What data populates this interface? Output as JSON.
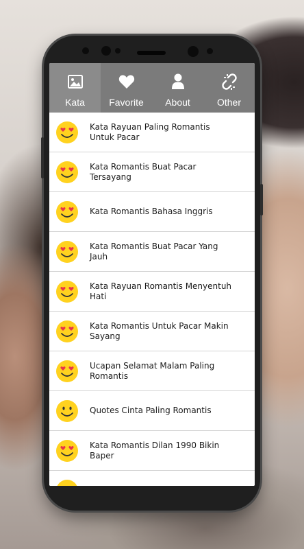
{
  "tabs": [
    {
      "label": "Kata",
      "icon": "image-icon",
      "active": true
    },
    {
      "label": "Favorite",
      "icon": "heart-icon",
      "active": false
    },
    {
      "label": "About",
      "icon": "person-icon",
      "active": false
    },
    {
      "label": "Other",
      "icon": "broken-link-icon",
      "active": false
    }
  ],
  "items": [
    {
      "title": "Kata Rayuan Paling Romantis Untuk Pacar"
    },
    {
      "title": "Kata Romantis Buat Pacar Tersayang"
    },
    {
      "title": "Kata Romantis Bahasa Inggris"
    },
    {
      "title": "Kata Romantis Buat Pacar Yang Jauh"
    },
    {
      "title": "Kata Rayuan Romantis Menyentuh Hati"
    },
    {
      "title": "Kata Romantis Untuk Pacar Makin Sayang"
    },
    {
      "title": "Ucapan Selamat Malam Paling Romantis"
    },
    {
      "title": "Quotes Cinta Paling Romantis"
    },
    {
      "title": "Kata Romantis Dilan 1990 Bikin Baper"
    }
  ],
  "colors": {
    "tabbar": "#7b7b7b",
    "tab_active": "#8b8b8b",
    "emoji_face": "#ffd21f",
    "emoji_heart": "#e8344a"
  }
}
